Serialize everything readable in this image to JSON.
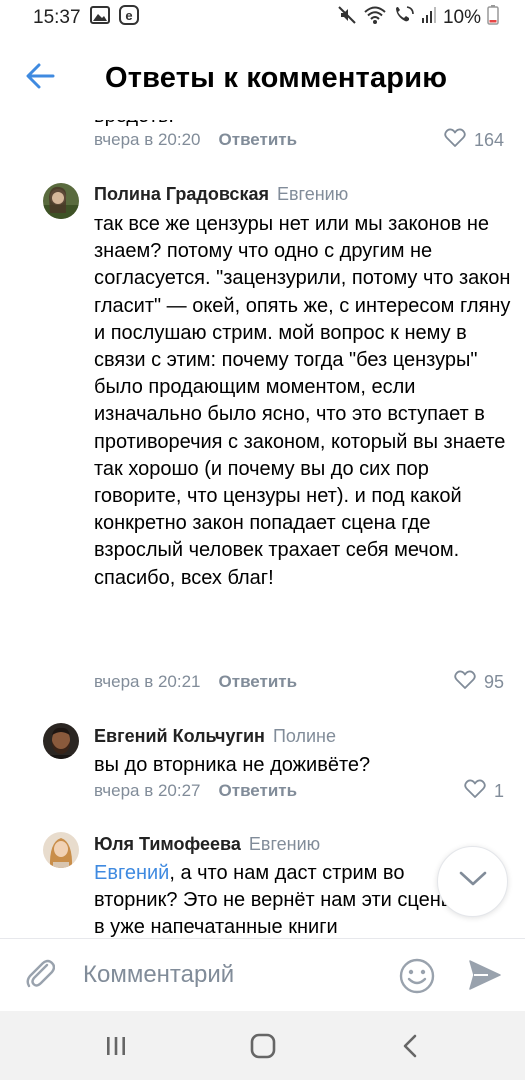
{
  "status_bar": {
    "time": "15:37",
    "battery": "10%",
    "icons": [
      "gallery-icon",
      "e-app-icon",
      "mute-icon",
      "wifi-icon",
      "call-signal-icon",
      "signal-icon",
      "battery-icon"
    ]
  },
  "header": {
    "title": "Ответы к комментарию",
    "back_icon": "arrow-left-icon"
  },
  "clipped_comment": {
    "text_fragment": "вредоть.",
    "time": "вчера в 20:20",
    "reply_label": "Ответить",
    "likes": "164"
  },
  "comments": [
    {
      "author": "Полина Градовская",
      "reply_to": "Евгению",
      "text": "так все же цензуры нет или мы законов не знаем? потому что одно с другим не согласуется. \"зацензурили, потому что закон гласит\" — окей, опять же, с интересом гляну и послушаю стрим. мой вопрос к нему в связи с этим: почему тогда \"без цензуры\" было продающим моментом, если изначально было ясно, что это вступает в противоречия с законом, который вы знаете так хорошо (и почему вы до сих пор говорите, что цензуры нет). и под какой конкретно закон попадает сцена где взрослый человек трахает себя мечом. спасибо, всех благ!",
      "time": "вчера в 20:21",
      "reply_label": "Ответить",
      "likes": "95"
    },
    {
      "author": "Евгений Кольчугин",
      "reply_to": "Полине",
      "text": "вы до вторника не доживёте?",
      "time": "вчера в 20:27",
      "reply_label": "Ответить",
      "likes": "1"
    },
    {
      "author": "Юля Тимофеева",
      "reply_to": "Евгению",
      "mention": "Евгений",
      "text": ", а что нам даст стрим во вторник? Это не вернёт нам эти сцены в уже напечатанные книги"
    }
  ],
  "composer": {
    "placeholder": "Комментарий",
    "attach_icon": "paperclip-icon",
    "emoji_icon": "smiley-icon",
    "send_icon": "send-icon"
  },
  "scroll_button_icon": "chevron-down-icon",
  "nav_bar": {
    "recents_icon": "recents-icon",
    "home_icon": "home-icon",
    "back_icon": "back-chevron-icon"
  },
  "colors": {
    "accent": "#2a5885",
    "link_blue": "#3f8ae0",
    "secondary_text": "#818c99",
    "divider": "#e7e8ec",
    "nav_bg": "#f2f2f2"
  }
}
